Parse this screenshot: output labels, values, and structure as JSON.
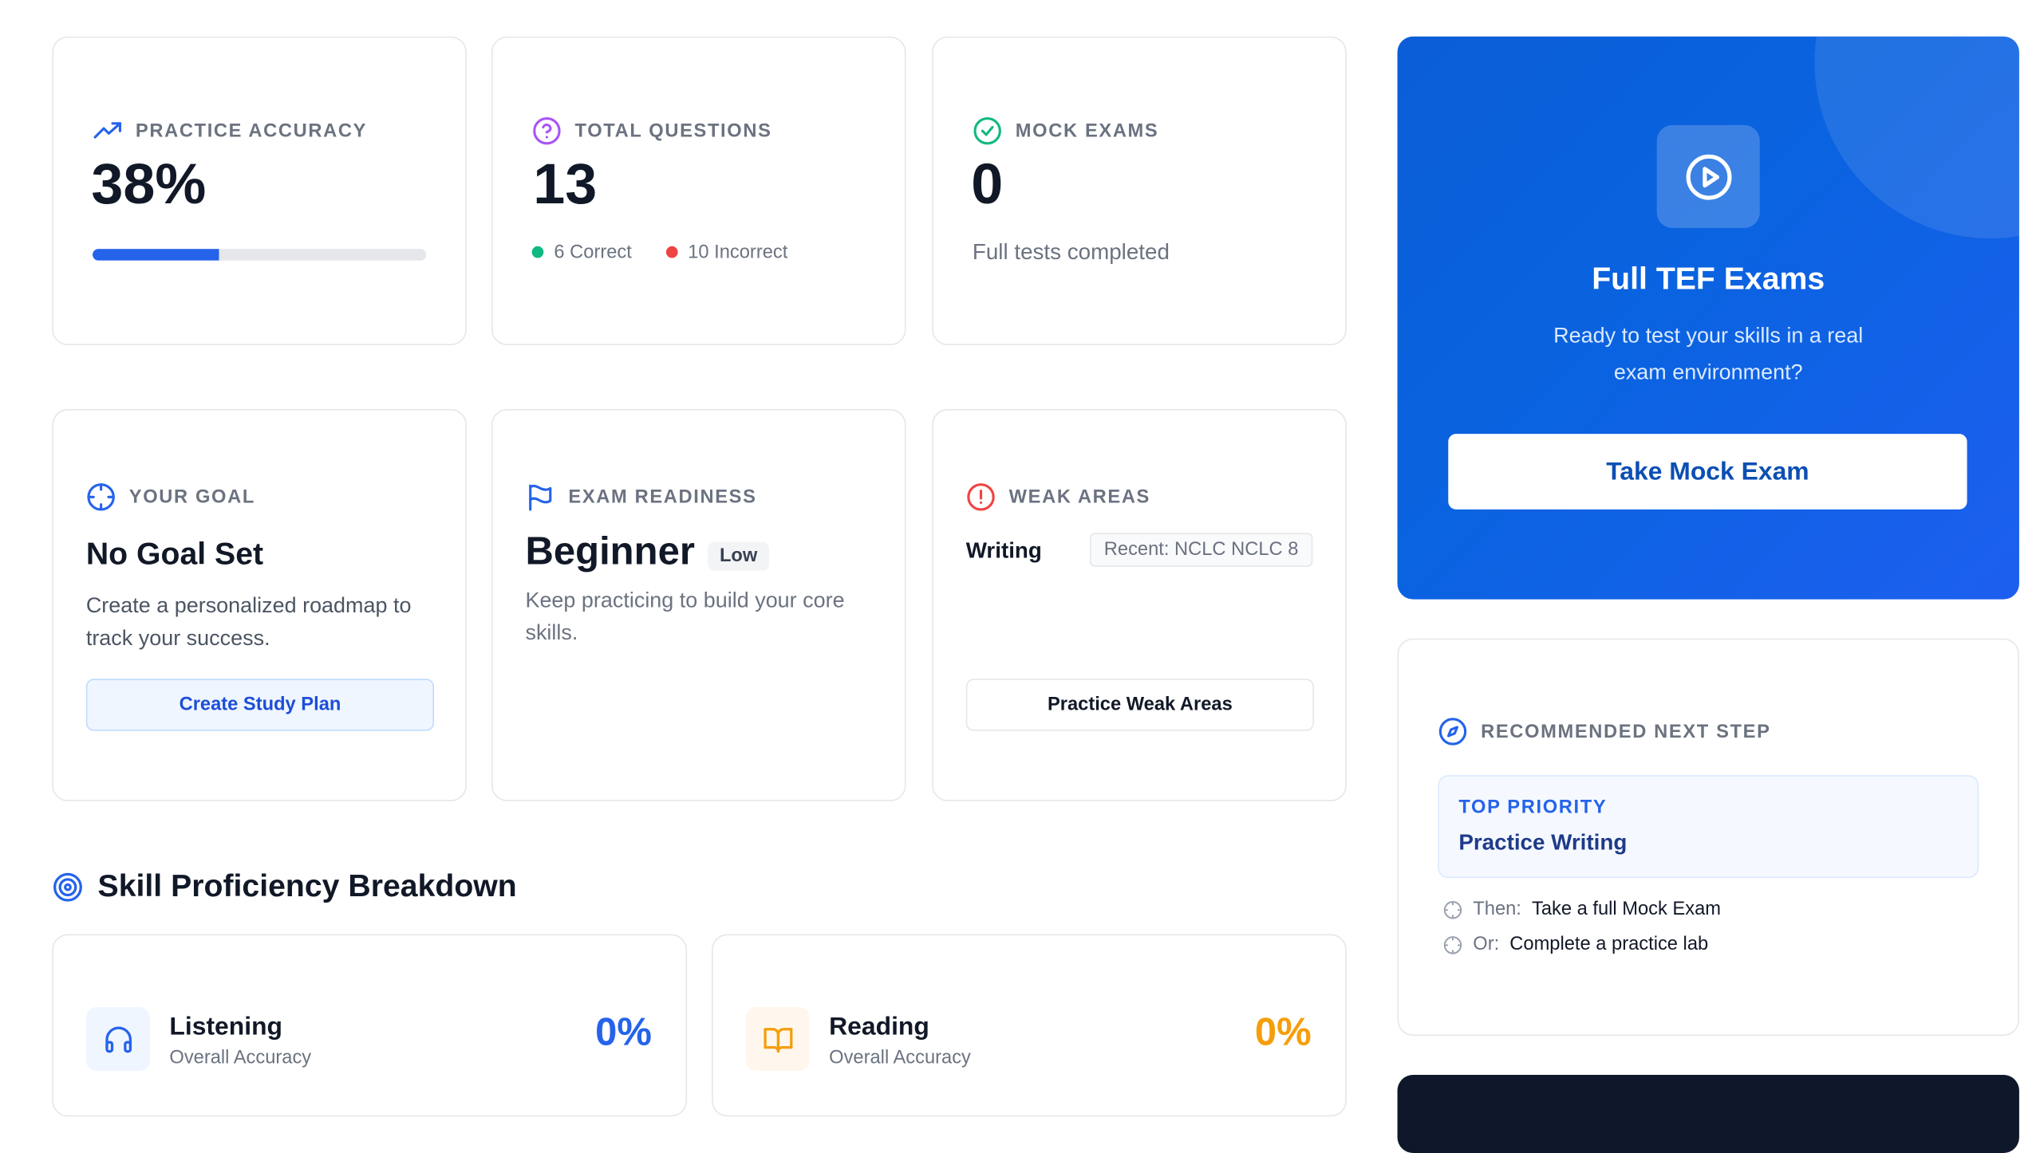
{
  "stats": {
    "accuracy": {
      "label": "PRACTICE ACCURACY",
      "value": "38%",
      "progress": 0.38
    },
    "questions": {
      "label": "TOTAL QUESTIONS",
      "value": "13",
      "correct": "6 Correct",
      "incorrect": "10 Incorrect"
    },
    "mock": {
      "label": "MOCK EXAMS",
      "value": "0",
      "sub": "Full tests completed"
    }
  },
  "goal": {
    "label": "YOUR GOAL",
    "title": "No Goal Set",
    "desc": "Create a personalized roadmap to track your success.",
    "button": "Create Study Plan"
  },
  "readiness": {
    "label": "EXAM READINESS",
    "title": "Beginner",
    "badge": "Low",
    "desc": "Keep practicing to build your core skills."
  },
  "weak": {
    "label": "WEAK AREAS",
    "skill": "Writing",
    "recent": "Recent: NCLC NCLC 8",
    "button": "Practice Weak Areas"
  },
  "skills_section": {
    "title": "Skill Proficiency Breakdown",
    "items": [
      {
        "name": "Listening",
        "sub": "Overall Accuracy",
        "value": "0%",
        "icon": "headphones-icon"
      },
      {
        "name": "Reading",
        "sub": "Overall Accuracy",
        "value": "0%",
        "icon": "book-icon"
      }
    ]
  },
  "tef": {
    "title": "Full TEF Exams",
    "desc": "Ready to test your skills in a real exam environment?",
    "button": "Take Mock Exam"
  },
  "next_step": {
    "label": "RECOMMENDED NEXT STEP",
    "priority_label": "TOP PRIORITY",
    "priority_value": "Practice Writing",
    "then_label": "Then:",
    "then_value": "Take a full Mock Exam",
    "or_label": "Or:",
    "or_value": "Complete a practice lab"
  },
  "colors": {
    "accent": "#2563eb",
    "brand_blue": "#0b5ed7",
    "correct": "#10b981",
    "incorrect": "#ef4444",
    "reading": "#f59e0b",
    "purple": "#a855f7"
  }
}
